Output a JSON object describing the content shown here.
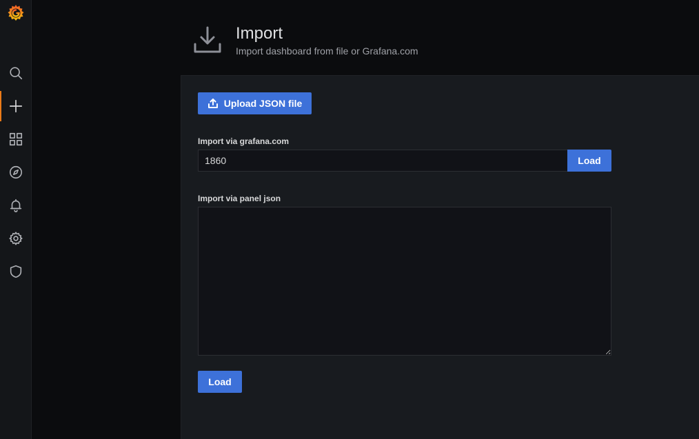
{
  "sidebar": {
    "logo_icon": "grafana-logo-icon",
    "items": [
      {
        "name": "search",
        "icon": "search-icon",
        "active": false
      },
      {
        "name": "create",
        "icon": "plus-icon",
        "active": true
      },
      {
        "name": "dashboards",
        "icon": "dashboards-grid-icon",
        "active": false
      },
      {
        "name": "explore",
        "icon": "compass-icon",
        "active": false
      },
      {
        "name": "alerting",
        "icon": "bell-icon",
        "active": false
      },
      {
        "name": "configuration",
        "icon": "gear-icon",
        "active": false
      },
      {
        "name": "server-admin",
        "icon": "shield-icon",
        "active": false
      }
    ],
    "active_accent": "#eb7b18"
  },
  "header": {
    "icon": "download-icon",
    "title": "Import",
    "subtitle": "Import dashboard from file or Grafana.com"
  },
  "main": {
    "upload_button": {
      "label": "Upload JSON file",
      "icon": "upload-icon"
    },
    "grafana_import": {
      "label": "Import via grafana.com",
      "value": "1860",
      "load_label": "Load"
    },
    "panel_json_import": {
      "label": "Import via panel json",
      "value": "",
      "load_label": "Load"
    }
  },
  "colors": {
    "primary_button": "#3d71d9",
    "panel_bg": "#181b1f",
    "page_bg": "#0b0c0e",
    "sidebar_bg": "#141619"
  }
}
